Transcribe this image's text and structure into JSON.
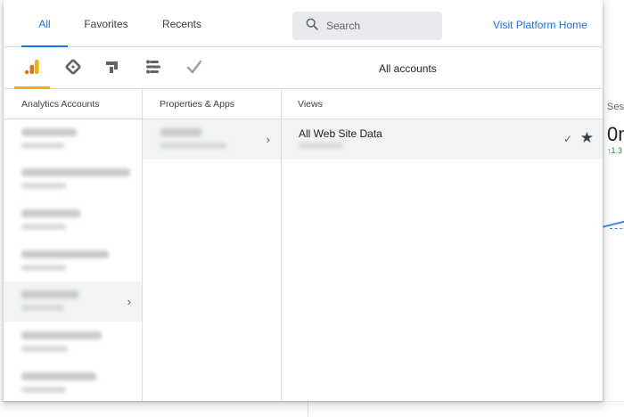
{
  "tabs": [
    {
      "label": "All",
      "active": true
    },
    {
      "label": "Favorites",
      "active": false
    },
    {
      "label": "Recents",
      "active": false
    }
  ],
  "search": {
    "placeholder": "Search"
  },
  "visit_link": "Visit Platform Home",
  "products": {
    "icons": [
      "analytics-bar-icon",
      "tag-manager-diamond-icon",
      "optimize-icon",
      "data-studio-icon",
      "surveys-check-icon"
    ],
    "active_index": 0,
    "accent_color": "#f9ab00"
  },
  "scope_label": "All accounts",
  "columns": {
    "accounts": "Analytics Accounts",
    "properties": "Properties & Apps",
    "views": "Views"
  },
  "accounts": {
    "selected_index": 4,
    "count": 7
  },
  "properties": {
    "selected_index": 0,
    "count": 1
  },
  "views": [
    {
      "name": "All Web Site Data",
      "selected": true,
      "favorite": true
    }
  ],
  "colors": {
    "accent": "#1a73e8",
    "selected_row": "#f1f3f4"
  }
}
